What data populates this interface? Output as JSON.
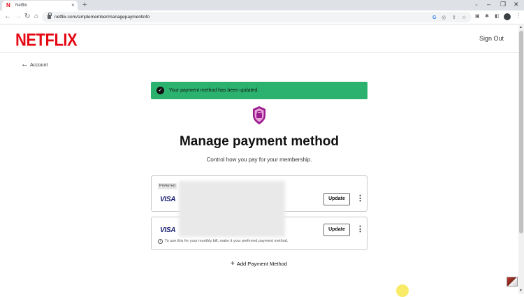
{
  "browser": {
    "tab_title": "Netflix",
    "tab_favicon": "N",
    "tab_close": "×",
    "new_tab": "+",
    "url": "netflix.com/simplemember/managepaymentinfo",
    "window_controls": [
      "‒",
      "❐",
      "✕"
    ]
  },
  "header": {
    "logo": "NETFLIX",
    "sign_out": "Sign Out"
  },
  "nav": {
    "back_label": "Account",
    "back_arrow": "←"
  },
  "banner": {
    "message": "Your payment method has been updated.",
    "check": "✓",
    "color": "#2bb26f"
  },
  "main": {
    "title": "Manage payment method",
    "subtitle": "Control how you pay for your membership."
  },
  "payment_methods": [
    {
      "badge": "Preferred",
      "brand": "VISA",
      "update_label": "Update",
      "more": "⋮"
    },
    {
      "brand": "VISA",
      "update_label": "Update",
      "more": "⋮",
      "note": "To use this for your monthly bill, make it your preferred payment method.",
      "note_icon": "i"
    }
  ],
  "add_method": {
    "icon": "+",
    "label": "Add Payment Method"
  },
  "colors": {
    "brand_red": "#e50914",
    "visa_blue": "#1a1f71",
    "shield_purple": "#9b1d8f"
  }
}
